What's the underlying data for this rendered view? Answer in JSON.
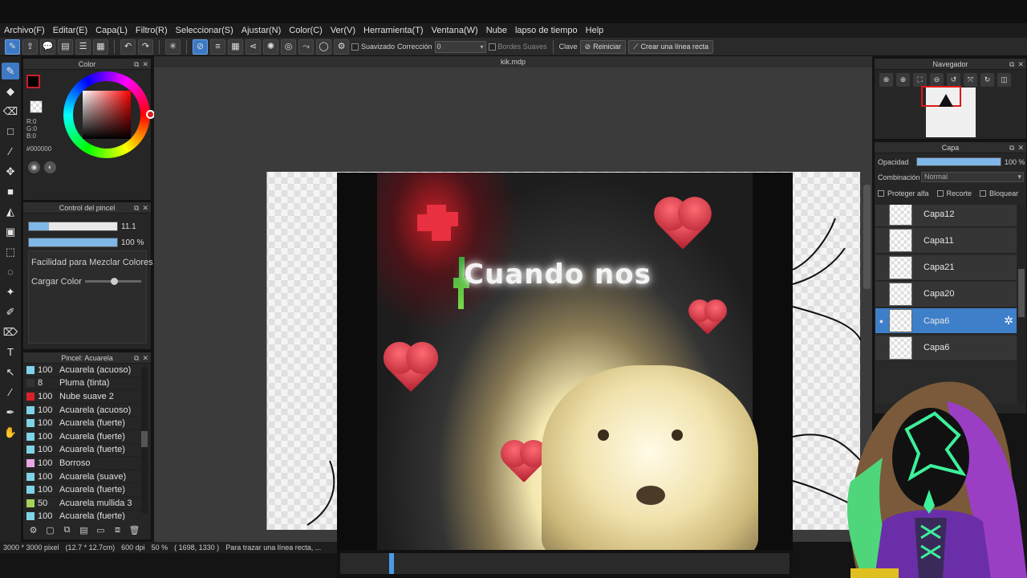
{
  "menu": [
    "Archivo(F)",
    "Editar(E)",
    "Capa(L)",
    "Filtro(R)",
    "Seleccionar(S)",
    "Ajustar(N)",
    "Color(C)",
    "Ver(V)",
    "Herramienta(T)",
    "Ventana(W)",
    "Nube",
    "lapso de tiempo",
    "Help"
  ],
  "toolbar": {
    "smooth_label": "Suavizado",
    "correction_label": "Corrección",
    "correction_value": "0",
    "soft_edges_label": "Bordes Suaves",
    "key_label": "Clave",
    "reset_label": "Reiniciar",
    "straight_line_label": "Crear una línea recta"
  },
  "color_panel": {
    "title": "Color",
    "r": "R:0",
    "g": "G:0",
    "b": "B:0",
    "hex": "#000000",
    "fg_color": "#000000",
    "accent": "#e01818"
  },
  "brush_control": {
    "title": "Control del pincel",
    "size_value": "11.1",
    "size_fill": 0.23,
    "opacity_value": "100 %",
    "opacity_fill": 1.0,
    "mix_label": "Facilidad para Mezclar Colores",
    "load_label": "Cargar Color"
  },
  "brush_list": {
    "title": "Pincel: Acuarela",
    "items": [
      {
        "num": "100",
        "name": "Acuarela (acuoso)",
        "color": "#7fd3e6"
      },
      {
        "num": "8",
        "name": "Pluma (tinta)",
        "color": "#333333"
      },
      {
        "num": "100",
        "name": "Nube suave 2",
        "color": "#d8222a"
      },
      {
        "num": "100",
        "name": "Acuarela (acuoso)",
        "color": "#7fd3e6"
      },
      {
        "num": "100",
        "name": "Acuarela (fuerte)",
        "color": "#7fd3e6"
      },
      {
        "num": "100",
        "name": "Acuarela (fuerte)",
        "color": "#7fd3e6"
      },
      {
        "num": "100",
        "name": "Acuarela (fuerte)",
        "color": "#7fd3e6"
      },
      {
        "num": "100",
        "name": "Borroso",
        "color": "#e8a6e6"
      },
      {
        "num": "100",
        "name": "Acuarela (suave)",
        "color": "#7fd3e6"
      },
      {
        "num": "100",
        "name": "Acuarela (fuerte)",
        "color": "#7fd3e6"
      },
      {
        "num": "50",
        "name": "Acuarela mullida 3",
        "color": "#a5d35a"
      },
      {
        "num": "100",
        "name": "Acuarela (fuerte)",
        "color": "#7fd3e6"
      }
    ]
  },
  "document": {
    "tab": "kik.mdp"
  },
  "video": {
    "caption": "Cuando  nos",
    "progress": 0.11
  },
  "status": {
    "size": "3000 * 3000 pixel",
    "cm": "(12.7 * 12.7cm)",
    "dpi": "600 dpi",
    "zoom": "50 %",
    "coords": "( 1698, 1330 )",
    "hint": "Para trazar una línea recta, ..."
  },
  "navigator": {
    "title": "Navegador"
  },
  "layer_panel": {
    "title": "Capa",
    "opacity_label": "Opacidad",
    "opacity_value": "100 %",
    "blend_label": "Combinación",
    "blend_value": "Normal",
    "protect_alpha": "Proteger alfa",
    "clipping": "Recorte",
    "lock": "Bloquear",
    "layers": [
      "Capa12",
      "Capa11",
      "Capa21",
      "Capa20",
      "Capa6",
      "Capa6"
    ],
    "selected_index": 4
  }
}
